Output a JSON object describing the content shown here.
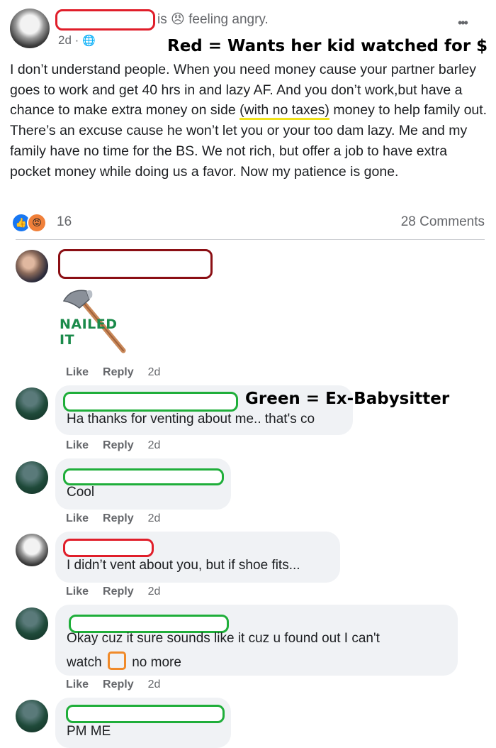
{
  "post": {
    "status_is": "is",
    "feeling_emoji": "😠",
    "feeling_text": "feeling angry.",
    "time": "2d ·",
    "globe_icon": "🌐",
    "more_icon": "•••",
    "annotation_red": "Red = Wants her kid watched for $",
    "body_1": "I don’t understand people. When you need money cause your partner barley goes to work and get 40 hrs in and lazy AF. And you don’t work,but have a chance to make extra money on side ",
    "body_highlight": "(with no taxes)",
    "body_2": " money to help family out. There’s an excuse cause he won’t let you or your too dam lazy. Me and my family have no time for the BS. We not rich, but offer a job to have extra pocket money while doing us a favor. Now my patience is gone.",
    "reaction_count": "16",
    "comments_count": "28 Comments"
  },
  "annotation_green": "Green = Ex-Babysitter",
  "sticker_text": "NAILED IT",
  "actions": {
    "like": "Like",
    "reply": "Reply",
    "time": "2d"
  },
  "comments": [
    {
      "text": ""
    },
    {
      "text": "Ha thanks for venting about me.. that's co"
    },
    {
      "text": "Cool"
    },
    {
      "text": "I didn’t vent about you, but if shoe fits..."
    },
    {
      "line1": "Okay cuz it sure sounds like it cuz u found out I can't",
      "line2a": "watch",
      "line2b": "no more"
    },
    {
      "text": "PM ME"
    }
  ]
}
